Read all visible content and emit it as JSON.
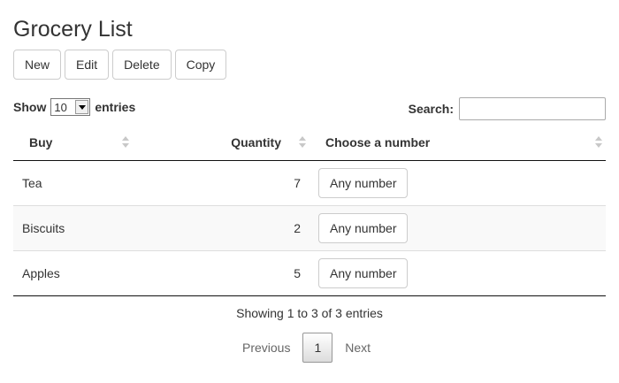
{
  "page": {
    "title": "Grocery List"
  },
  "toolbar": {
    "new_label": "New",
    "edit_label": "Edit",
    "delete_label": "Delete",
    "copy_label": "Copy"
  },
  "length": {
    "show_label": "Show",
    "value": "10",
    "entries_label": "entries"
  },
  "search": {
    "label": "Search:",
    "value": ""
  },
  "table": {
    "columns": [
      "Buy",
      "Quantity",
      "Choose a number"
    ],
    "rows": [
      {
        "buy": "Tea",
        "quantity": "7",
        "action": "Any number"
      },
      {
        "buy": "Biscuits",
        "quantity": "2",
        "action": "Any number"
      },
      {
        "buy": "Apples",
        "quantity": "5",
        "action": "Any number"
      }
    ]
  },
  "info": "Showing 1 to 3 of 3 entries",
  "pagination": {
    "previous": "Previous",
    "current": "1",
    "next": "Next"
  }
}
